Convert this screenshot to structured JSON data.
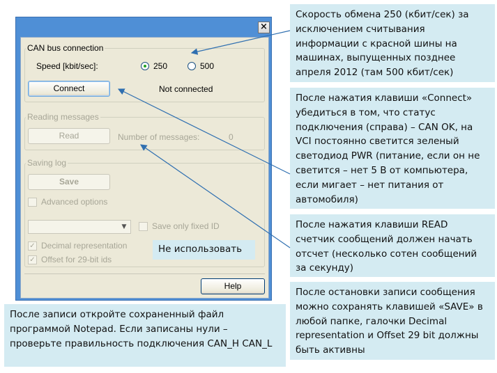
{
  "window": {
    "close_glyph": "×"
  },
  "can_bus": {
    "title": "CAN bus connection",
    "speed_label": "Speed [kbit/sec]:",
    "options": [
      {
        "label": "250",
        "selected": true
      },
      {
        "label": "500",
        "selected": false
      }
    ],
    "connect_button": "Connect",
    "status": "Not connected"
  },
  "reading": {
    "title": "Reading messages",
    "read_button": "Read",
    "count_label": "Number of messages:",
    "count_value": "0"
  },
  "saving": {
    "title": "Saving log",
    "save_button": "Save",
    "advanced_label": "Advanced options",
    "advanced_checked": false,
    "combo_value": "",
    "save_fixed_label": "Save only fixed ID",
    "save_fixed_checked": false,
    "decimal_label": "Decimal representation",
    "decimal_checked": true,
    "offset_label": "Offset for 29-bit ids",
    "offset_checked": true
  },
  "help_button": "Help",
  "callouts": {
    "speed": "Скорость обмена 250 (кбит/сек) за исключением считывания информации с красной шины на машинах, выпущенных позднее апреля 2012 (там 500 кбит/сек)",
    "connect": "После нажатия клавиши «Connect» убедиться в том, что статус подключения (справа) – CAN OK, на VCI постоянно светится зеленый светодиод PWR (питание, если он не светится – нет 5 В от компьютера, если мигает – нет питания от автомобиля)",
    "read": "После нажатия клавиши READ счетчик сообщений должен начать отсчет (несколько сотен сообщений за секунду)",
    "save": "После остановки записи сообщения можно сохранять клавишей «SAVE» в любой папке, галочки Decimal representation и Offset 29 bit должны быть активны",
    "notepad": "После записи откройте сохраненный файл программой Notepad. Если записаны нули – проверьте правильность подключения CAN_H CAN_L",
    "no_use": "Не использовать"
  },
  "colors": {
    "callout_bg": "#d4ebf2",
    "window_frame": "#4f8fd6",
    "dialog_bg": "#ece9d8",
    "arrow": "#2f6fb0"
  }
}
